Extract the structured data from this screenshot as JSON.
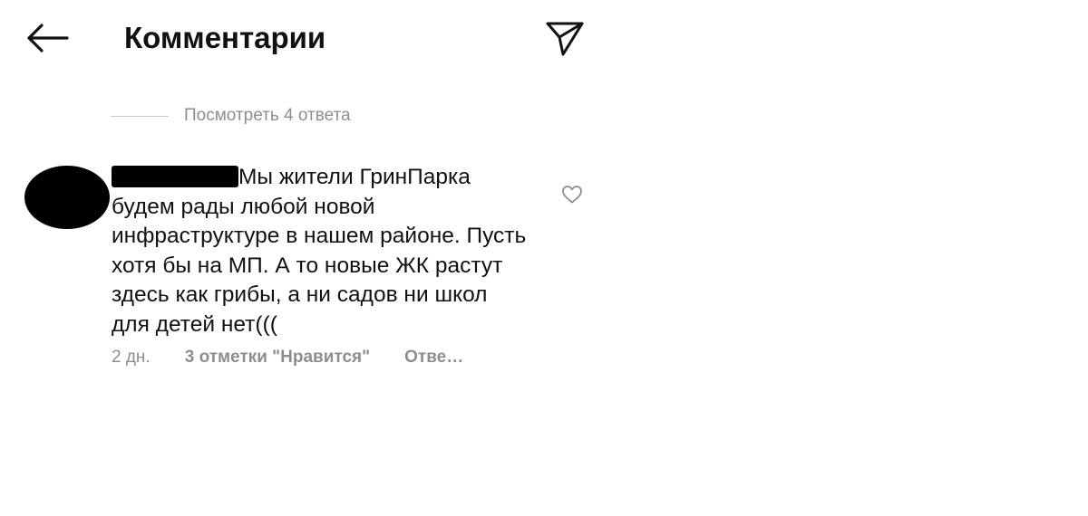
{
  "header": {
    "title": "Комментарии",
    "back_icon": "arrow-left-icon",
    "share_icon": "paper-plane-icon"
  },
  "replies": {
    "view_label": "Посмотреть 4 ответа"
  },
  "comment": {
    "avatar_icon": "avatar-redacted",
    "username_redacted": true,
    "text": "Мы жители  ГринПарка будем рады любой новой инфраструктуре в нашем районе. Пусть хотя бы на МП. А то новые ЖК растут здесь как грибы, а ни садов ни школ для детей нет(((",
    "like_icon": "heart-outline-icon",
    "time": "2 дн.",
    "likes": "3 отметки \"Нравится\"",
    "reply": "Отве…"
  },
  "colors": {
    "text_primary": "#111111",
    "text_secondary": "#8e8e8e",
    "divider": "#c7c7c7",
    "background": "#ffffff",
    "redaction": "#000000"
  }
}
